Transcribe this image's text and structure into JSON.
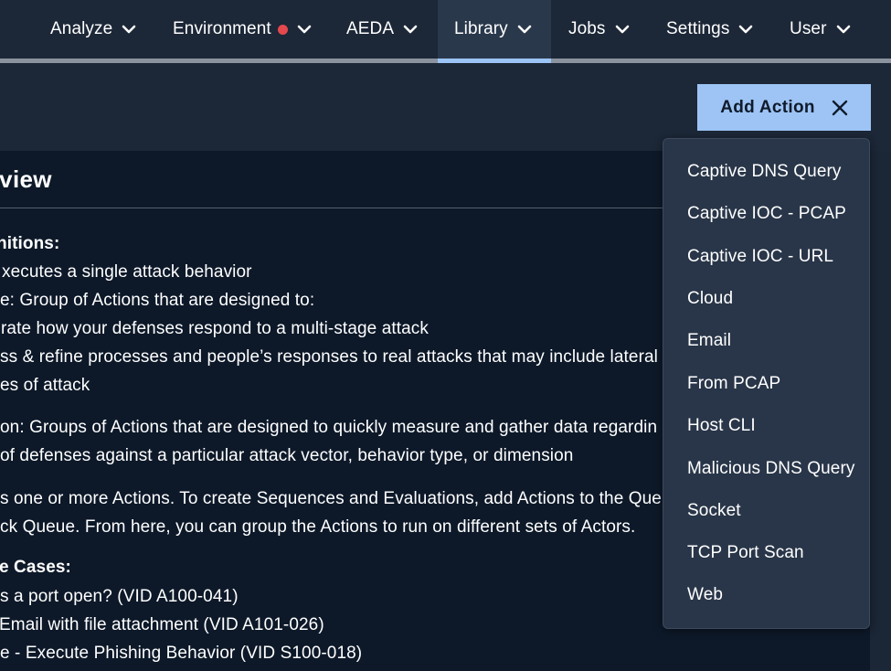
{
  "nav": {
    "items": [
      {
        "label": "Analyze"
      },
      {
        "label": "Environment"
      },
      {
        "label": "AEDA"
      },
      {
        "label": "Library"
      },
      {
        "label": "Jobs"
      },
      {
        "label": "Settings"
      },
      {
        "label": "User"
      }
    ],
    "active": "Library",
    "alert_dot_color": "#e5484d"
  },
  "header": {
    "add_action_label": "Add Action"
  },
  "panel": {
    "title": "review",
    "lines": [
      "nitions:",
      "xecutes a single attack behavior",
      "e: Group of Actions that are designed to:",
      "rate how your defenses respond to a multi-stage attack",
      "ss & refine processes and people’s responses to real attacks that may include lateral",
      "es of attack",
      "on: Groups of Actions that are designed to quickly measure and gather data regardin",
      "of defenses against a particular attack vector, behavior type, or dimension",
      "s one or more Actions. To create Sequences and Evaluations, add Actions to the Queu",
      "ck Queue. From here, you can group the Actions to run on different sets of Actors.",
      "e Cases:",
      "s a port open? (VID A100-041)",
      "Email with file attachment (VID A101-026)",
      "e - Execute Phishing Behavior (VID S100-018)"
    ]
  },
  "dropdown": {
    "items": [
      "Captive DNS Query",
      "Captive IOC - PCAP",
      "Captive IOC - URL",
      "Cloud",
      "Email",
      "From PCAP",
      "Host CLI",
      "Malicious DNS Query",
      "Socket",
      "TCP Port Scan",
      "Web"
    ]
  },
  "colors": {
    "nav_bg": "#1c2737",
    "panel_bg": "#0d1929",
    "accent": "#9dc4f5",
    "dropdown_bg": "#293649"
  }
}
